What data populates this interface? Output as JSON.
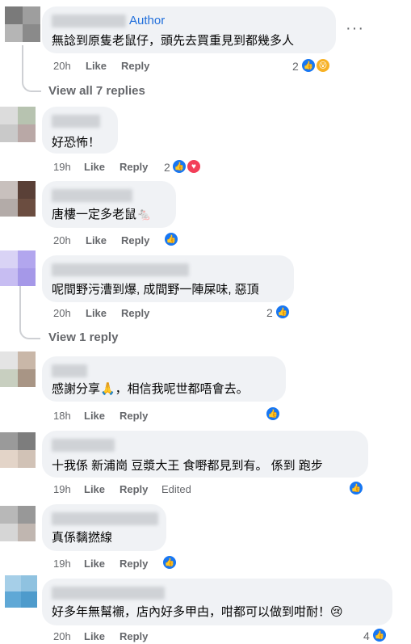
{
  "comments": [
    {
      "author_tag": "Author",
      "text": "無諗到原隻老鼠仔，頭先去買重見到都幾多人",
      "time": "20h",
      "like": "Like",
      "reply": "Reply",
      "reaction_count": "2",
      "reactions": [
        "like",
        "wow"
      ],
      "more_icon": "more-horizontal-icon",
      "avatar_colors": [
        "#7a7a7a",
        "#9e9e9e",
        "#b5b5b5",
        "#8a8a8a"
      ]
    },
    {
      "text": "好恐怖！",
      "time": "19h",
      "like": "Like",
      "reply": "Reply",
      "reaction_count": "2",
      "reactions": [
        "like",
        "love"
      ],
      "avatar_colors": [
        "#dcdcdc",
        "#b7c3b0",
        "#c9c9c9",
        "#b9a8a6"
      ]
    },
    {
      "text": "唐樓一定多老鼠🐁",
      "time": "20h",
      "like": "Like",
      "reply": "Reply",
      "reaction_count": "",
      "reactions": [
        "like"
      ],
      "avatar_colors": [
        "#c8c0bd",
        "#5a4037",
        "#b3aba8",
        "#6b4d40"
      ]
    },
    {
      "text": "呢間野污漕到爆, 成間野一陣屎味, 惡頂",
      "time": "20h",
      "like": "Like",
      "reply": "Reply",
      "reaction_count": "2",
      "reactions": [
        "like"
      ],
      "avatar_colors": [
        "#d9d3f5",
        "#b2a6ee",
        "#c7bdf2",
        "#a598e8"
      ]
    },
    {
      "text": "感謝分享🙏，相信我呢世都唔會去。",
      "time": "18h",
      "like": "Like",
      "reply": "Reply",
      "reaction_count": "",
      "reactions": [
        "like"
      ],
      "avatar_colors": [
        "#e4e4e4",
        "#c9b7a8",
        "#c8cfc0",
        "#a89585"
      ]
    },
    {
      "text": "十我係 新浦崗 豆漿大王 食嘢都見到有。 係到 跑步",
      "time": "19h",
      "like": "Like",
      "reply": "Reply",
      "edited": "Edited",
      "reaction_count": "",
      "reactions": [
        "like"
      ],
      "avatar_colors": [
        "#9a9a9a",
        "#7d7d7d",
        "#e3d4c8",
        "#d1c2b6"
      ]
    },
    {
      "text": "真係黐撚線",
      "time": "19h",
      "like": "Like",
      "reply": "Reply",
      "reaction_count": "",
      "reactions": [
        "like"
      ],
      "avatar_colors": [
        "#b8b8b8",
        "#989898",
        "#d6d6d6",
        "#c0b6b0"
      ]
    },
    {
      "text": "好多年無幫襯，店內好多甲甴，咁都可以做到咁耐！😢",
      "time": "20h",
      "like": "Like",
      "reply": "Reply",
      "reaction_count": "4",
      "reactions": [
        "like"
      ],
      "avatar_colors": [
        "#a6cfe8",
        "#8fc2e0",
        "#5fa8d6",
        "#4e9bcc"
      ]
    }
  ],
  "view_replies": [
    "View all 7 replies",
    "View 1 reply"
  ]
}
